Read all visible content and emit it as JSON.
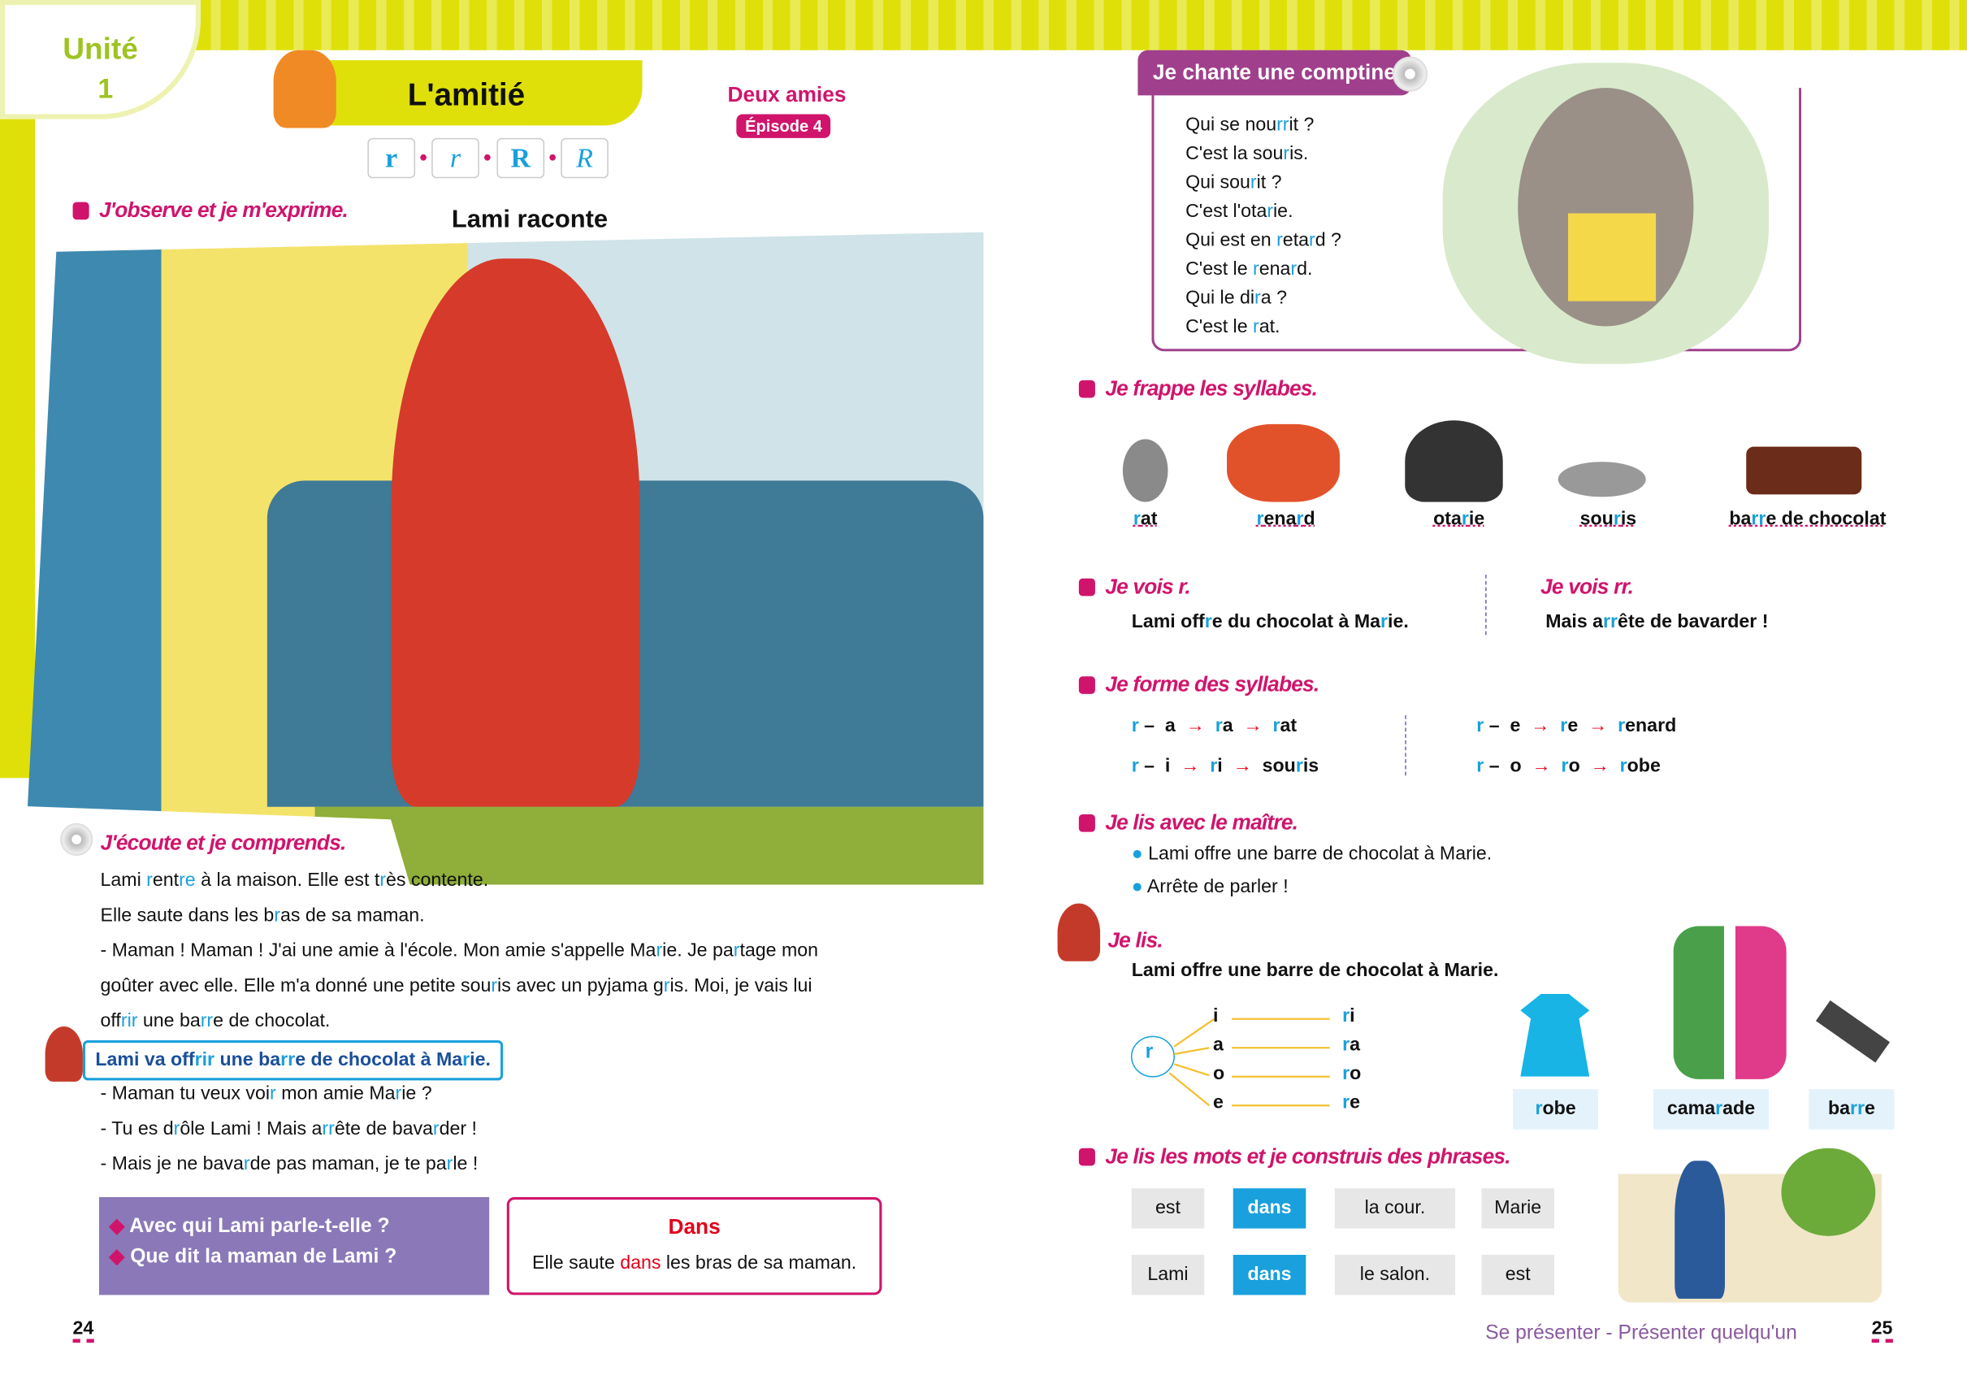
{
  "header": {
    "unit_label": "Unité",
    "unit_number": "1",
    "title": "L'amitié",
    "story_title": "Deux amies",
    "episode": "Épisode 4",
    "letters": [
      "r",
      "r",
      "R",
      "R"
    ]
  },
  "left": {
    "observe_heading": "J'observe et je m'exprime.",
    "image_caption": "Lami raconte",
    "listen_heading": "J'écoute et je comprends.",
    "story": [
      [
        "Lami ",
        "r",
        "ent",
        "re",
        " à la maison. Elle est t",
        "r",
        "ès contente."
      ],
      [
        "Elle saute dans les b",
        "r",
        "as de sa maman."
      ],
      [
        "- Maman ! Maman ! J'ai une amie à l'école. Mon amie s'appelle Ma",
        "r",
        "ie. Je  pa",
        "r",
        "tage mon"
      ],
      [
        "goûter avec elle. Elle m'a donné une petite sou",
        "r",
        "is avec un pyjama g",
        "r",
        "is. Moi, je vais lui"
      ],
      [
        "off",
        "rir",
        " une ba",
        "rr",
        "e de chocolat."
      ]
    ],
    "highlight_sentence": [
      "Lami va off",
      "rir",
      " une ba",
      "rr",
      "e de chocolat à Ma",
      "r",
      "ie."
    ],
    "story2": [
      [
        "- Maman tu veux voi",
        "r",
        " mon amie Ma",
        "r",
        "ie ?"
      ],
      [
        "- Tu es d",
        "r",
        "ôle Lami ! Mais a",
        "rr",
        "ête de bava",
        "r",
        "der !"
      ],
      [
        "- Mais je ne bava",
        "r",
        "de pas maman, je te pa",
        "r",
        "le !"
      ]
    ],
    "questions": [
      "Avec qui Lami parle-t-elle ?",
      "Que dit la maman de Lami ?"
    ],
    "dans_box": {
      "title": "Dans",
      "sentence": [
        "Elle saute ",
        "dans",
        " les bras de sa maman."
      ]
    },
    "page_number": "24"
  },
  "right": {
    "comptine_heading": "Je chante une comptine",
    "comptine": [
      [
        "Qui se nou",
        "rr",
        "it ?"
      ],
      [
        "C'est la sou",
        "r",
        "is."
      ],
      [
        "Qui sou",
        "r",
        "it ?"
      ],
      [
        "C'est l'ota",
        "r",
        "ie."
      ],
      [
        "Qui est en ",
        "r",
        "eta",
        "r",
        "d ?"
      ],
      [
        "C'est le ",
        "r",
        "ena",
        "r",
        "d."
      ],
      [
        "Qui le di",
        "r",
        "a ?"
      ],
      [
        "C'est le ",
        "r",
        "at."
      ]
    ],
    "syllabes_heading": "Je frappe les syllabes.",
    "animals": [
      [
        "",
        "r",
        "at"
      ],
      [
        "",
        "r",
        "ena",
        "r",
        "d"
      ],
      [
        "ota",
        "r",
        "ie"
      ],
      [
        "sou",
        "r",
        "is"
      ],
      [
        "ba",
        "rr",
        "e de chocolat"
      ]
    ],
    "vois_r_heading": "Je vois r.",
    "vois_r": [
      "Lami off",
      "r",
      "e du chocolat à Ma",
      "r",
      "ie."
    ],
    "vois_rr_heading": "Je vois rr.",
    "vois_rr": [
      "Mais a",
      "rr",
      "ête de bavarder !"
    ],
    "forme_heading": "Je forme des syllabes.",
    "forme": [
      [
        "",
        "r",
        " –  a  ",
        "→",
        "  ",
        "r",
        "a  ",
        "→",
        "  ",
        "r",
        "at"
      ],
      [
        "",
        "r",
        " –  i  ",
        "→",
        "  ",
        "r",
        "i  ",
        "→",
        "  sou",
        "r",
        "is"
      ],
      [
        "",
        "r",
        " –  e  ",
        "→",
        "  ",
        "r",
        "e  ",
        "→",
        "  ",
        "r",
        "enard"
      ],
      [
        "",
        "r",
        " –  o  ",
        "→",
        "  ",
        "r",
        "o  ",
        "→",
        "  ",
        "r",
        "obe"
      ]
    ],
    "maitre_heading": "Je lis avec le maître.",
    "maitre": [
      "Lami offre une barre de chocolat à Marie.",
      "Arrête de parler !"
    ],
    "lis_heading": "Je lis.",
    "lis_sentence": "Lami offre une barre de chocolat à Marie.",
    "tree": {
      "root": "r",
      "vowels": [
        "i",
        "a",
        "o",
        "e"
      ],
      "results": [
        [
          "",
          "r",
          "i"
        ],
        [
          "",
          "r",
          "a"
        ],
        [
          "",
          "r",
          "o"
        ],
        [
          "",
          "r",
          "e"
        ]
      ]
    },
    "words": [
      [
        "",
        "r",
        "obe"
      ],
      [
        "cama",
        "r",
        "ade"
      ],
      [
        "ba",
        "rr",
        "e"
      ]
    ],
    "phrases_heading": "Je lis les mots et je construis des phrases.",
    "tiles": [
      [
        "est",
        "dans",
        "la cour.",
        "Marie"
      ],
      [
        "Lami",
        "dans",
        "le salon.",
        "est"
      ]
    ],
    "footer": "Se présenter - Présenter quelqu'un",
    "page_number": "25"
  },
  "colors": {
    "accent": "#d0146c",
    "highlight": "#1aa0dc",
    "yellow": "#dfe00a",
    "violet": "#8a78b8"
  }
}
